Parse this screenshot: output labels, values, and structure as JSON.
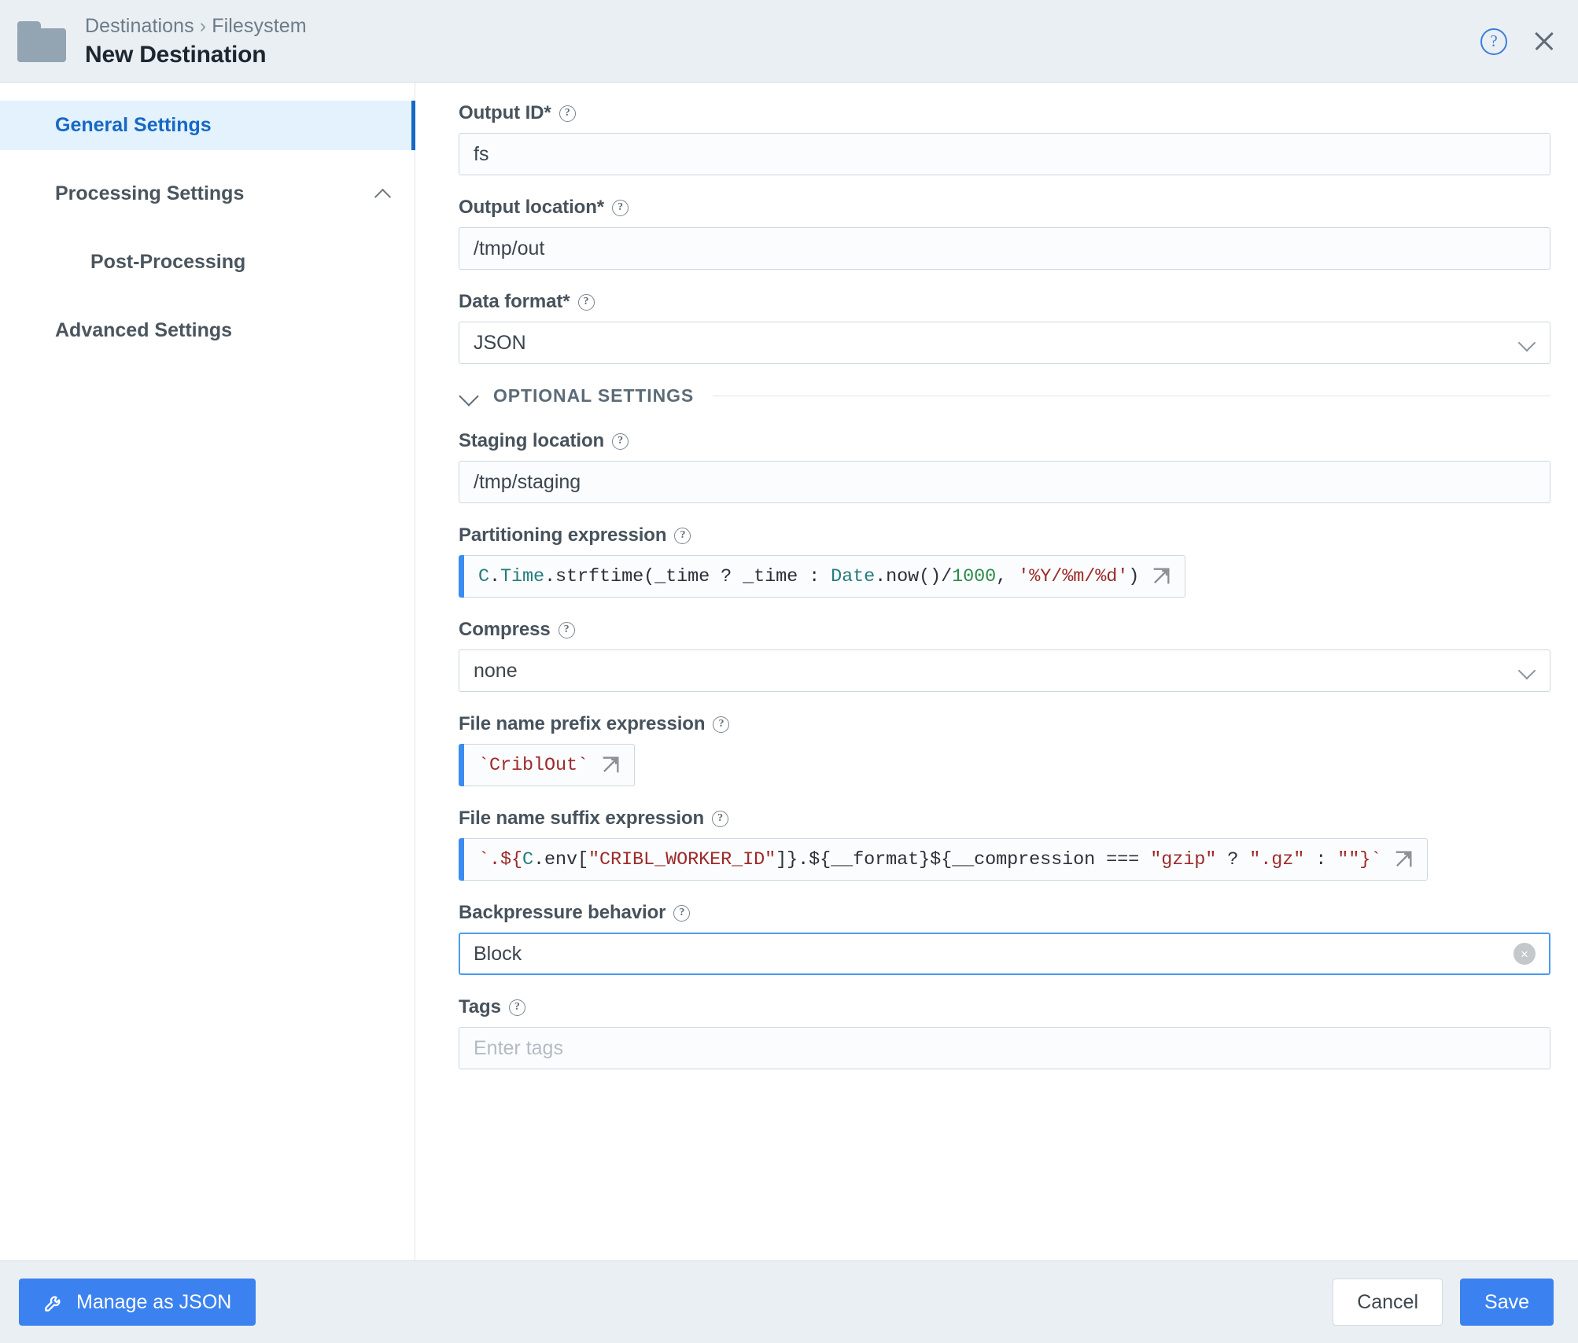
{
  "header": {
    "folder_icon": "folder-icon",
    "breadcrumb": {
      "root": "Destinations",
      "separator": "›",
      "current": "Filesystem"
    },
    "title": "New Destination",
    "help_label": "?",
    "close_label": "×"
  },
  "sidebar": {
    "items": [
      {
        "label": "General Settings",
        "active": true,
        "sub": false,
        "chevron": null
      },
      {
        "label": "Processing Settings",
        "active": false,
        "sub": false,
        "chevron": "chevron-up-icon"
      },
      {
        "label": "Post-Processing",
        "active": false,
        "sub": true,
        "chevron": null
      },
      {
        "label": "Advanced Settings",
        "active": false,
        "sub": false,
        "chevron": null
      }
    ]
  },
  "form": {
    "output_id": {
      "label": "Output ID*",
      "value": "fs"
    },
    "output_location": {
      "label": "Output location*",
      "value": "/tmp/out"
    },
    "data_format": {
      "label": "Data format*",
      "value": "JSON"
    },
    "optional_settings": {
      "label": "OPTIONAL SETTINGS"
    },
    "staging_location": {
      "label": "Staging location",
      "value": "/tmp/staging"
    },
    "partitioning_expression": {
      "label": "Partitioning expression",
      "value": "C.Time.strftime(_time ? _time : Date.now()/1000, '%Y/%m/%d')",
      "tokens": [
        {
          "t": "C",
          "c": "class"
        },
        {
          "t": ".",
          "c": "plain"
        },
        {
          "t": "Time",
          "c": "class"
        },
        {
          "t": ".strftime(_time ? _time : ",
          "c": "plain"
        },
        {
          "t": "Date",
          "c": "class"
        },
        {
          "t": ".now()/",
          "c": "plain"
        },
        {
          "t": "1000",
          "c": "num"
        },
        {
          "t": ", ",
          "c": "plain"
        },
        {
          "t": "'%Y/%m/%d'",
          "c": "str"
        },
        {
          "t": ")",
          "c": "plain"
        }
      ]
    },
    "compress": {
      "label": "Compress",
      "value": "none"
    },
    "file_name_prefix_expression": {
      "label": "File name prefix expression",
      "value": "`CriblOut`",
      "tokens": [
        {
          "t": "`CriblOut`",
          "c": "tpl"
        }
      ]
    },
    "file_name_suffix_expression": {
      "label": "File name suffix expression",
      "value": "`.${C.env[\"CRIBL_WORKER_ID\"]}.${__format}${__compression === \"gzip\" ? \".gz\" : \"\"}`",
      "tokens": [
        {
          "t": "`.${",
          "c": "tpl"
        },
        {
          "t": "C",
          "c": "class"
        },
        {
          "t": ".env[",
          "c": "plain"
        },
        {
          "t": "\"CRIBL_WORKER_ID\"",
          "c": "str"
        },
        {
          "t": "]}.${__format}${__compression === ",
          "c": "plain"
        },
        {
          "t": "\"gzip\"",
          "c": "str"
        },
        {
          "t": " ? ",
          "c": "plain"
        },
        {
          "t": "\".gz\"",
          "c": "str"
        },
        {
          "t": " : ",
          "c": "plain"
        },
        {
          "t": "\"\"",
          "c": "str"
        },
        {
          "t": "}`",
          "c": "tpl"
        }
      ]
    },
    "backpressure_behavior": {
      "label": "Backpressure behavior",
      "value": "Block",
      "clear_label": "×"
    },
    "tags": {
      "label": "Tags",
      "value": "",
      "placeholder": "Enter tags"
    },
    "help_hint": "?",
    "expand_icon": "expand-icon"
  },
  "footer": {
    "manage_as_json": "Manage as JSON",
    "cancel": "Cancel",
    "save": "Save"
  },
  "colors": {
    "accent": "#3b82f0",
    "active_nav": "#1668c5",
    "active_nav_bg": "#e3f2fd",
    "header_bg": "#eaeff3",
    "code_bar": "#3b8cf0",
    "string_token": "#9c2a2a",
    "class_token": "#247c7f",
    "number_token": "#2a8a4a"
  }
}
